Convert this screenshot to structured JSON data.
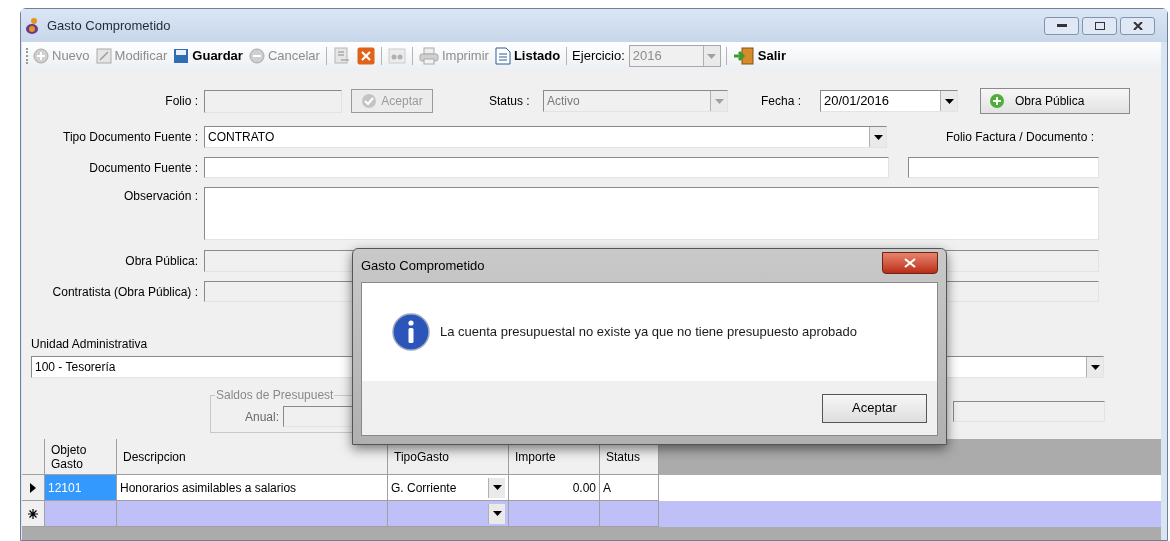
{
  "window": {
    "title": "Gasto Comprometido"
  },
  "toolbar": {
    "groups": [
      [
        {
          "kind": "new",
          "label": "Nuevo",
          "disabled": true
        },
        {
          "kind": "edit",
          "label": "Modificar",
          "disabled": true
        },
        {
          "kind": "save",
          "label": "Guardar",
          "disabled": false
        },
        {
          "kind": "cancel",
          "label": "Cancelar",
          "disabled": true
        }
      ],
      [
        {
          "kind": "refresh",
          "disabled": true
        },
        {
          "kind": "delete",
          "disabled": false
        }
      ],
      [
        {
          "kind": "search",
          "disabled": true
        }
      ],
      [
        {
          "kind": "print",
          "label": "Imprimir",
          "disabled": true
        },
        {
          "kind": "list",
          "label": "Listado",
          "disabled": false
        }
      ],
      [
        {
          "kind": "combo",
          "label": "Ejercicio:",
          "value": "2016",
          "disabled": true
        }
      ],
      [
        {
          "kind": "exit",
          "label": "Salir",
          "disabled": false
        }
      ]
    ]
  },
  "form": {
    "folio": {
      "label": "Folio :",
      "disabled": true
    },
    "accept_button": {
      "label": "Aceptar",
      "disabled": true
    },
    "status": {
      "label": "Status :",
      "value": "Activo",
      "disabled": true
    },
    "fecha": {
      "label": "Fecha :",
      "value": "20/01/2016"
    },
    "obra_button": {
      "label": "Obra Pública"
    },
    "tipo_documento": {
      "label": "Tipo Documento Fuente :",
      "value": "CONTRATO"
    },
    "folio_factura": {
      "label": "Folio Factura / Documento :"
    },
    "documento_fuente": {
      "label": "Documento Fuente :"
    },
    "observacion": {
      "label": "Observación :"
    },
    "obra_publica": {
      "label": "Obra Pública:",
      "disabled": true
    },
    "contratista": {
      "label": "Contratista (Obra Pública) :",
      "disabled": true
    },
    "unidad": {
      "label": "Unidad Administrativa",
      "value": "100 - Tesorería"
    },
    "saldos": {
      "title": "Saldos de Presupuest",
      "anual_label": "Anual:"
    }
  },
  "grid": {
    "columns": [
      {
        "title": "Objeto Gasto",
        "kind": "text"
      },
      {
        "title": "Descripcion",
        "kind": "text"
      },
      {
        "title": "TipoGasto",
        "kind": "combo"
      },
      {
        "title": "Importe",
        "kind": "number"
      },
      {
        "title": "Status",
        "kind": "text"
      }
    ],
    "rows": [
      {
        "kind": "current",
        "cells": [
          {
            "text": "12101",
            "selected": true
          },
          {
            "text": "Honorarios asimilables a salarios",
            "selected": false
          },
          {
            "text": "G. Corriente",
            "selected": false
          },
          {
            "text": "0.00",
            "selected": false
          },
          {
            "text": "A",
            "selected": false
          }
        ]
      },
      {
        "kind": "new"
      }
    ]
  },
  "dialog": {
    "title": "Gasto Comprometido",
    "message": "La cuenta presupuestal no existe ya que no tiene presupuesto aprobado",
    "button": "Aceptar"
  }
}
